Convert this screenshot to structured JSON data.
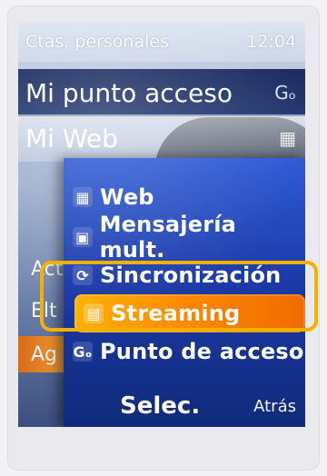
{
  "status": {
    "title": "Ctas. personales",
    "time": "12:04"
  },
  "background": {
    "items": [
      {
        "label": "Mi punto acceso",
        "icon": "Gₒ"
      },
      {
        "label": "Mi Web",
        "icon": "web-icon"
      }
    ],
    "side_labels": [
      "Act",
      "Elt",
      "Ag"
    ]
  },
  "menu": {
    "items": [
      {
        "label": "Web",
        "icon": "web-icon"
      },
      {
        "label": "Mensajería mult.",
        "icon": "mms-icon"
      },
      {
        "label": "Sincronización",
        "icon": "sync-icon"
      },
      {
        "label": "Streaming",
        "icon": "streaming-icon"
      },
      {
        "label": "Punto de acceso",
        "icon": "access-point-icon"
      }
    ],
    "selected_index": 3
  },
  "softkeys": {
    "left": "Selec.",
    "right": "Atrás"
  },
  "colors": {
    "highlight": "#f2b000",
    "menu_bg": "#1c3aa8",
    "selected": "#ff8b00"
  }
}
